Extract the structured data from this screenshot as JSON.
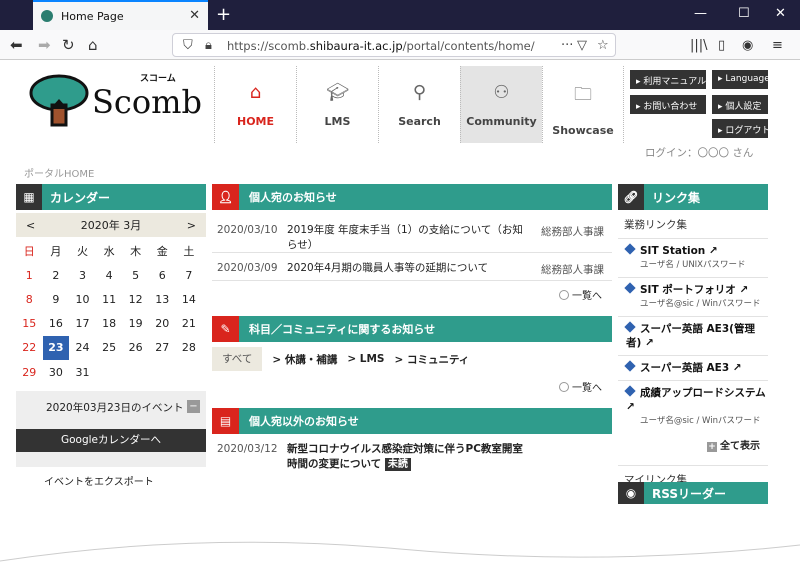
{
  "browser": {
    "tab_title": "Home Page",
    "url_prefix": "https://scomb.",
    "url_host": "shibaura-it.ac.jp",
    "url_path": "/portal/contents/home/"
  },
  "header": {
    "logo_kana": "スコーム",
    "logo_text": "Scomb",
    "tabs": [
      {
        "id": "home",
        "label": "HOME",
        "icon": "house-icon"
      },
      {
        "id": "lms",
        "label": "LMS",
        "icon": "graduation-cap-icon"
      },
      {
        "id": "search",
        "label": "Search",
        "icon": "magnifier-icon"
      },
      {
        "id": "comm",
        "label": "Community",
        "icon": "people-icon"
      },
      {
        "id": "show",
        "label": "Showcase",
        "icon": "folder-icon"
      }
    ],
    "buttons": {
      "manual": "▸ 利用マニュアル",
      "language": "▸ Language",
      "contact": "▸ お問い合わせ",
      "settings": "▸ 個人設定",
      "logout": "▸ ログアウト"
    }
  },
  "breadcrumb": "ポータルHOME",
  "login": "ログイン：〇〇〇 さん",
  "calendar": {
    "title": "カレンダー",
    "month": "2020年 3月",
    "prev": "<",
    "next": ">",
    "weekdays": [
      "日",
      "月",
      "火",
      "水",
      "木",
      "金",
      "土"
    ],
    "days": [
      "1",
      "2",
      "3",
      "4",
      "5",
      "6",
      "7",
      "8",
      "9",
      "10",
      "11",
      "12",
      "13",
      "14",
      "15",
      "16",
      "17",
      "18",
      "19",
      "20",
      "21",
      "22",
      "23",
      "24",
      "25",
      "26",
      "27",
      "28",
      "29",
      "30",
      "31"
    ],
    "selected": "23",
    "event_title": "2020年03月23日のイベント",
    "minus": "−",
    "google_button": "Googleカレンダーへ",
    "export": "イベントをエクスポート"
  },
  "notices": {
    "title": "個人宛のお知らせ",
    "rows": [
      {
        "date": "2020/03/10",
        "text": "2019年度 年度末手当（1）の支給について（お知らせ）",
        "dept": "総務部人事課"
      },
      {
        "date": "2020/03/09",
        "text": "2020年4月期の職員人事等の延期について",
        "dept": "総務部人事課"
      }
    ],
    "more": "一覧へ"
  },
  "community": {
    "title": "科目／コミュニティに関するお知らせ",
    "tabs": [
      "すべて",
      "> 休講・補講",
      "> LMS",
      "> コミュニティ"
    ],
    "more": "一覧へ"
  },
  "others": {
    "title": "個人宛以外のお知らせ",
    "rows": [
      {
        "date": "2020/03/12",
        "text": "新型コロナウイルス感染症対策に伴うPC教室開室時間の変更について",
        "badge": "未読"
      }
    ]
  },
  "links": {
    "title": "リンク集",
    "section": "業務リンク集",
    "items": [
      {
        "label": "SIT Station",
        "sub": "ユーザ名 / UNIXパスワード"
      },
      {
        "label": "SIT ポートフォリオ",
        "sub": "ユーザ名@sic / Winパスワード"
      },
      {
        "label": "スーパー英語 AE3(管理者)",
        "sub": ""
      },
      {
        "label": "スーパー英語 AE3",
        "sub": ""
      },
      {
        "label": "成績アップロードシステム",
        "sub": "ユーザ名@sic / Winパスワード"
      }
    ],
    "show_all": "全て表示",
    "my_links": "マイリンク集",
    "rss": "RSSリーダー"
  }
}
